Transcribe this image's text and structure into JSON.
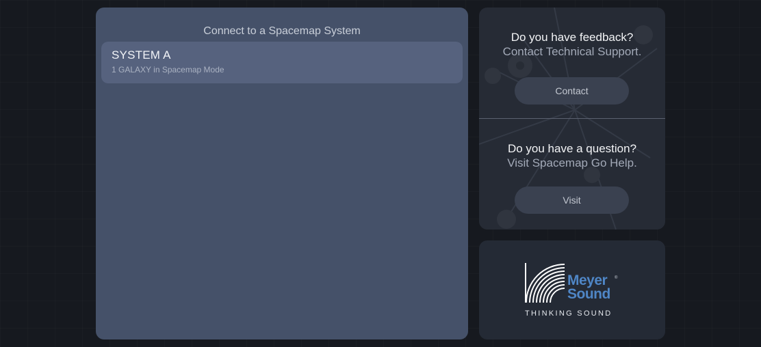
{
  "systems": {
    "title": "Connect to a Spacemap System",
    "items": [
      {
        "name": "SYSTEM A",
        "subtitle": "1 GALAXY in Spacemap Mode"
      }
    ]
  },
  "support": {
    "feedback": {
      "heading": "Do you have feedback?",
      "subheading": "Contact Technical Support.",
      "button_label": "Contact"
    },
    "question": {
      "heading": "Do you have a question?",
      "subheading": "Visit Spacemap Go Help.",
      "button_label": "Visit"
    }
  },
  "brand": {
    "name_line1": "Meyer",
    "name_line2": "Sound",
    "registered": "®",
    "tagline": "THINKING SOUND",
    "colors": {
      "accent": "#4f86c6"
    }
  }
}
